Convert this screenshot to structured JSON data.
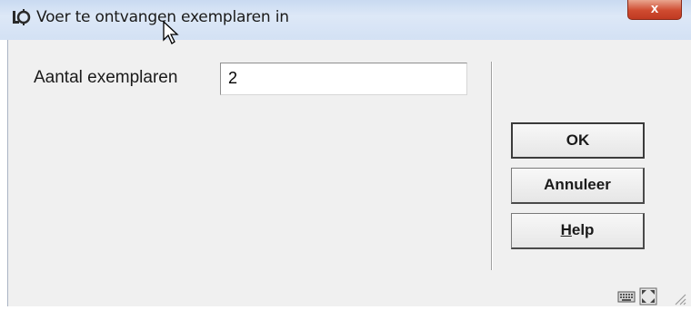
{
  "window": {
    "title": "Voer te ontvangen exemplaren in",
    "close_label": "x"
  },
  "form": {
    "label": "Aantal exemplaren",
    "value": "2"
  },
  "buttons": {
    "ok": "OK",
    "cancel": "Annuleer",
    "help_prefix": "H",
    "help_rest": "elp"
  },
  "icons": {
    "app": "app-icon",
    "close": "close-icon",
    "keyboard": "keyboard-icon",
    "maximize": "maximize-icon",
    "resize": "resize-grip-icon",
    "cursor": "mouse-cursor-icon"
  },
  "colors": {
    "titlebar": "#d3e1f4",
    "close_button": "#cf4b30",
    "client": "#f0f0f0"
  }
}
